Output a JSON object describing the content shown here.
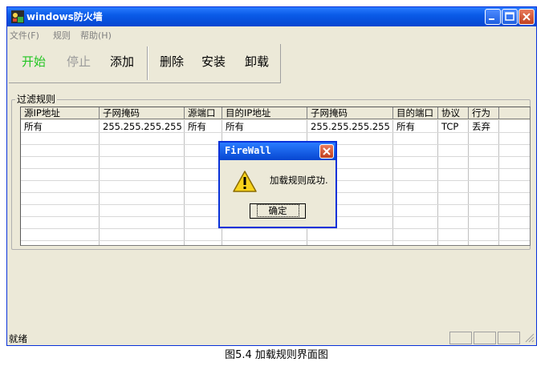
{
  "window": {
    "title": "windows防火墙"
  },
  "menu": [
    "文件(F)",
    "规则",
    "帮助(H)"
  ],
  "toolbar": [
    {
      "label": "开始",
      "color": "#22c522",
      "enabled": true
    },
    {
      "label": "停止",
      "color": "#9a9a9a",
      "enabled": false
    },
    {
      "label": "添加",
      "color": "#000000",
      "enabled": true
    },
    {
      "label": "删除",
      "color": "#000000",
      "enabled": true
    },
    {
      "label": "安装",
      "color": "#000000",
      "enabled": true
    },
    {
      "label": "卸载",
      "color": "#000000",
      "enabled": true
    }
  ],
  "rules_group": {
    "label": "过滤规则"
  },
  "table": {
    "columns": [
      "源IP地址",
      "子网掩码",
      "源端口",
      "目的IP地址",
      "子网掩码",
      "目的端口",
      "协议",
      "行为"
    ],
    "rows": [
      [
        "所有",
        "255.255.255.255",
        "所有",
        "所有",
        "255.255.255.255",
        "所有",
        "TCP",
        "丢弃"
      ]
    ]
  },
  "status": {
    "text": "就绪"
  },
  "dialog": {
    "title": "FireWall",
    "message": "加载规则成功.",
    "ok_label": "确定",
    "icon": "warning-icon"
  },
  "caption": "图5.4 加载规则界面图"
}
